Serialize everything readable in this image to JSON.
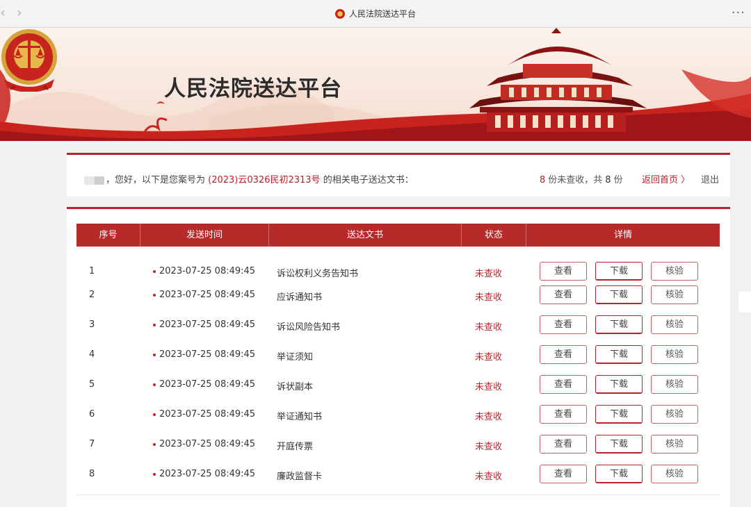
{
  "browser": {
    "tab_title": "人民法院送达平台",
    "back_icon": "chevron-left-icon",
    "forward_icon": "chevron-right-icon",
    "more_icon": "more-icon"
  },
  "banner": {
    "site_name": "人民法院送达平台",
    "emblem_icon": "court-emblem-icon"
  },
  "info": {
    "greeting_prefix": "，您好，以下是您案号为",
    "case_number": "(2023)云0326民初2313号",
    "greeting_suffix": "的相关电子送达文书：",
    "unread_count": "8",
    "unread_text": "份未查收，共",
    "total_count": "8",
    "total_unit": "份",
    "home_link": "返回首页 〉",
    "logout": "退出"
  },
  "table": {
    "headers": {
      "index": "序号",
      "send_time": "发送时间",
      "document": "送达文书",
      "status": "状态",
      "detail": "详情"
    },
    "buttons": {
      "view": "查看",
      "download": "下载",
      "verify": "核验"
    },
    "rows": [
      {
        "index": "1",
        "time": "2023-07-25  08:49:45",
        "document": "诉讼权利义务告知书",
        "status": "未查收"
      },
      {
        "index": "2",
        "time": "2023-07-25  08:49:45",
        "document": "应诉通知书",
        "status": "未查收"
      },
      {
        "index": "3",
        "time": "2023-07-25  08:49:45",
        "document": "诉讼风险告知书",
        "status": "未查收"
      },
      {
        "index": "4",
        "time": "2023-07-25  08:49:45",
        "document": "举证须知",
        "status": "未查收"
      },
      {
        "index": "5",
        "time": "2023-07-25  08:49:45",
        "document": "诉状副本",
        "status": "未查收"
      },
      {
        "index": "6",
        "time": "2023-07-25  08:49:45",
        "document": "举证通知书",
        "status": "未查收"
      },
      {
        "index": "7",
        "time": "2023-07-25  08:49:45",
        "document": "开庭传票",
        "status": "未查收"
      },
      {
        "index": "8",
        "time": "2023-07-25  08:49:45",
        "document": "廉政监督卡",
        "status": "未查收"
      }
    ]
  },
  "colors": {
    "accent_red": "#b8202a",
    "header_red": "#b72a2a",
    "status_red": "#c0262c"
  }
}
